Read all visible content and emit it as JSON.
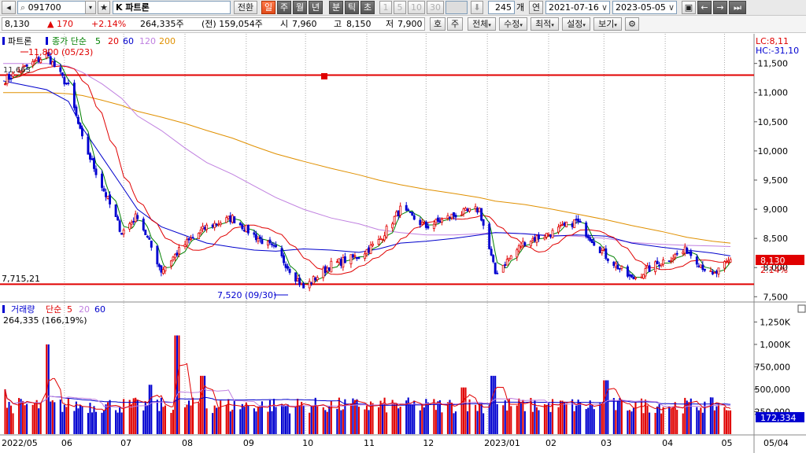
{
  "toolbar": {
    "code": "091700",
    "stock_name": "K 파트론",
    "btn_jeonhwan": "전환",
    "period_tabs": [
      "일",
      "주",
      "월",
      "년",
      "분",
      "틱",
      "초"
    ],
    "active_period": "일",
    "unit_buttons": [
      "1",
      "5",
      "10",
      "30"
    ],
    "count": "245",
    "count_unit": "개",
    "year_btn": "연",
    "date_from": "2021-07-16",
    "date_to": "2023-05-05"
  },
  "quote": {
    "price": "8,130",
    "change": "▲ 170",
    "change_pct": "+2.14%",
    "volume": "264,335주",
    "prev_volume": "(전) 159,054주",
    "open_label": "시",
    "open": "7,960",
    "high_label": "고",
    "high": "8,150",
    "low_label": "저",
    "low": "7,900",
    "btn_ho": "호",
    "btn_ju": "주",
    "menu": [
      "전체",
      "수정",
      "최적",
      "설정",
      "보기"
    ]
  },
  "price_panel": {
    "legend_name": "파트론",
    "legend_ma_label": "종가 단순",
    "legend_ma": [
      "5",
      "20",
      "60",
      "120",
      "200"
    ],
    "lc": "LC:8,11",
    "hc": "HC:-31,10",
    "high_marker": "11,800 (05/23)",
    "top_label": "11,663",
    "low_marker": "7,520 (09/30)",
    "support_label": "7,715,21",
    "last_price_box": "8,130",
    "last_pct": "2.14%"
  },
  "volume_panel": {
    "legend_name": "거래량",
    "legend_ma_label": "단순",
    "legend_ma": [
      "5",
      "20",
      "60"
    ],
    "value_line": "264,335 (166,19%)",
    "last_volume_box": "172,334"
  },
  "x_axis": {
    "labels": [
      "2022/05",
      "06",
      "07",
      "08",
      "09",
      "10",
      "11",
      "12",
      "2023/01",
      "02",
      "03",
      "04",
      "05"
    ],
    "right_label": "05/04"
  },
  "colors": {
    "up": "#e00000",
    "down": "#0000d0",
    "ma5": "#008000",
    "ma20": "#e00000",
    "ma60": "#0000cc",
    "ma120": "#c080e0",
    "ma200": "#e09000",
    "hline": "#e00000"
  },
  "chart_data": {
    "type": "candlestick",
    "title": "",
    "xlabel": "",
    "ylabel": "",
    "price_axis_ticks": [
      "11,500",
      "11,000",
      "10,500",
      "10,000",
      "9,500",
      "9,000",
      "8,500",
      "8,000",
      "7,500"
    ],
    "price_ylim": [
      7450,
      11900
    ],
    "volume_axis_ticks": [
      "1,250K",
      "1,000K",
      "750,000",
      "500,000",
      "250,000"
    ],
    "volume_ylim": [
      0,
      1350000
    ],
    "horizontal_lines": [
      11300,
      7715
    ],
    "price_series": [
      {
        "date": "2022-05-01",
        "close": 11200
      },
      {
        "date": "2022-05-23",
        "close": 11650
      },
      {
        "date": "2022-06-03",
        "close": 11100
      },
      {
        "date": "2022-06-10",
        "close": 10200
      },
      {
        "date": "2022-06-20",
        "close": 9400
      },
      {
        "date": "2022-06-30",
        "close": 8600
      },
      {
        "date": "2022-07-08",
        "close": 8900
      },
      {
        "date": "2022-07-20",
        "close": 7950
      },
      {
        "date": "2022-08-01",
        "close": 8400
      },
      {
        "date": "2022-08-12",
        "close": 8700
      },
      {
        "date": "2022-08-25",
        "close": 8850
      },
      {
        "date": "2022-09-05",
        "close": 8550
      },
      {
        "date": "2022-09-16",
        "close": 8300
      },
      {
        "date": "2022-09-30",
        "close": 7650
      },
      {
        "date": "2022-10-14",
        "close": 8050
      },
      {
        "date": "2022-10-28",
        "close": 8200
      },
      {
        "date": "2022-11-07",
        "close": 8450
      },
      {
        "date": "2022-11-18",
        "close": 9000
      },
      {
        "date": "2022-12-01",
        "close": 8700
      },
      {
        "date": "2022-12-15",
        "close": 8900
      },
      {
        "date": "2022-12-28",
        "close": 9000
      },
      {
        "date": "2023-01-05",
        "close": 7900
      },
      {
        "date": "2023-01-20",
        "close": 8450
      },
      {
        "date": "2023-02-03",
        "close": 8600
      },
      {
        "date": "2023-02-15",
        "close": 8800
      },
      {
        "date": "2023-03-02",
        "close": 8200
      },
      {
        "date": "2023-03-15",
        "close": 7800
      },
      {
        "date": "2023-03-30",
        "close": 8100
      },
      {
        "date": "2023-04-12",
        "close": 8300
      },
      {
        "date": "2023-04-25",
        "close": 7850
      },
      {
        "date": "2023-05-04",
        "close": 8130
      }
    ],
    "ma_series": {
      "ma60": [
        11200,
        11050,
        10850,
        10400,
        9900,
        9400,
        9000,
        8700,
        8550,
        8420,
        8350,
        8300,
        8280,
        8320,
        8300,
        8260,
        8320,
        8420,
        8450,
        8500,
        8560,
        8600,
        8580,
        8540,
        8560,
        8540,
        8420,
        8350,
        8300,
        8250,
        8200
      ],
      "ma120": [
        11500,
        11500,
        11450,
        11350,
        11150,
        10900,
        10600,
        10350,
        10050,
        9800,
        9600,
        9400,
        9200,
        9000,
        8850,
        8750,
        8650,
        8600,
        8560,
        8560,
        8580,
        8600,
        8580,
        8550,
        8540,
        8500,
        8430,
        8400,
        8380,
        8370,
        8360
      ],
      "ma200": [
        11000,
        11000,
        10980,
        10950,
        10870,
        10780,
        10680,
        10580,
        10470,
        10350,
        10220,
        10080,
        9950,
        9820,
        9700,
        9590,
        9500,
        9420,
        9340,
        9270,
        9200,
        9140,
        9080,
        9000,
        8920,
        8820,
        8720,
        8620,
        8520,
        8450,
        8420
      ]
    },
    "volume_series": [
      {
        "date": "2022-05-01",
        "volume": 500000
      },
      {
        "date": "2022-05-23",
        "volume": 1000000
      },
      {
        "date": "2022-07-15",
        "volume": 550000
      },
      {
        "date": "2022-07-28",
        "volume": 1100000
      },
      {
        "date": "2022-08-10",
        "volume": 650000
      },
      {
        "date": "2022-12-20",
        "volume": 520000
      },
      {
        "date": "2023-01-04",
        "volume": 650000
      },
      {
        "date": "2023-03-02",
        "volume": 600000
      },
      {
        "date": "2023-05-04",
        "volume": 264335
      }
    ]
  }
}
